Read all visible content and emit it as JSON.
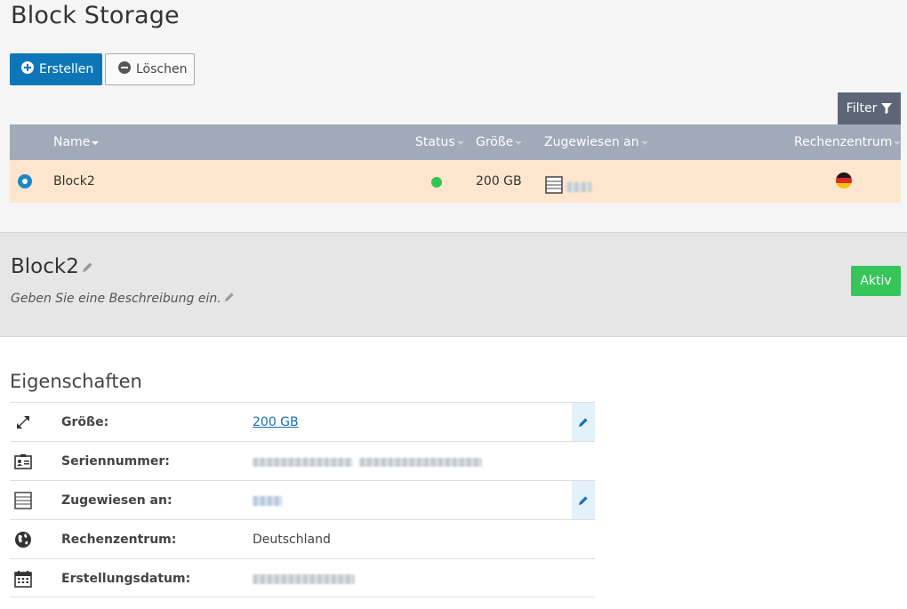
{
  "page": {
    "title": "Block Storage"
  },
  "toolbar": {
    "create_label": "Erstellen",
    "delete_label": "Löschen",
    "filter_label": "Filter"
  },
  "table": {
    "columns": {
      "name": "Name",
      "status": "Status",
      "size": "Größe",
      "assigned": "Zugewiesen an",
      "datacenter": "Rechenzentrum"
    },
    "rows": [
      {
        "name": "Block2",
        "status": "active",
        "size": "200 GB",
        "assigned": "",
        "datacenter_flag": "de"
      }
    ]
  },
  "detail": {
    "name": "Block2",
    "description_placeholder": "Geben Sie eine Beschreibung ein.",
    "status_badge": "Aktiv"
  },
  "properties": {
    "title": "Eigenschaften",
    "size_label": "Größe:",
    "size_value": "200 GB",
    "serial_label": "Seriennummer:",
    "assigned_label": "Zugewiesen an:",
    "datacenter_label": "Rechenzentrum:",
    "datacenter_value": "Deutschland",
    "created_label": "Erstellungsdatum:"
  },
  "colors": {
    "primary": "#0d76b8",
    "header": "#a1aab8",
    "selected_row": "#fde6cd",
    "status_active": "#2ec84e",
    "badge_active": "#36c559"
  }
}
